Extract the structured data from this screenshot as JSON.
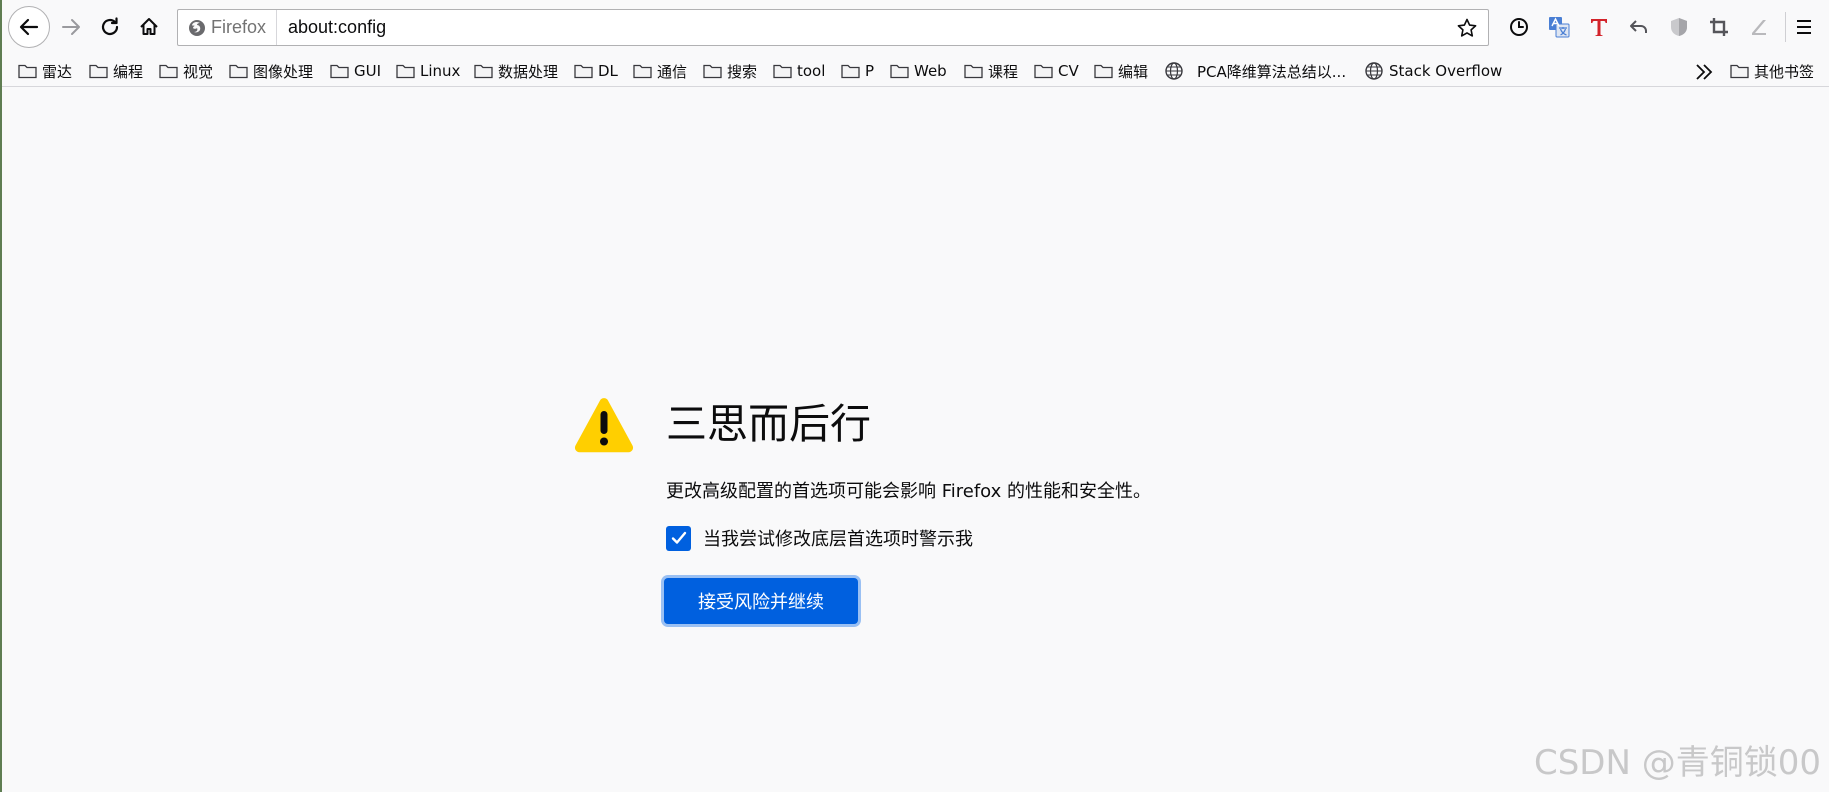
{
  "browser": {
    "identity_label": "Firefox",
    "url": "about:config"
  },
  "bookmarks": [
    {
      "label": "雷达",
      "icon": "folder-icon"
    },
    {
      "label": "编程",
      "icon": "folder-icon"
    },
    {
      "label": "视觉",
      "icon": "folder-icon"
    },
    {
      "label": "图像处理",
      "icon": "folder-icon"
    },
    {
      "label": "GUI",
      "icon": "folder-icon"
    },
    {
      "label": "Linux",
      "icon": "folder-icon"
    },
    {
      "label": "数据处理",
      "icon": "folder-icon"
    },
    {
      "label": "DL",
      "icon": "folder-icon"
    },
    {
      "label": "通信",
      "icon": "folder-icon"
    },
    {
      "label": "搜索",
      "icon": "folder-icon"
    },
    {
      "label": "tool",
      "icon": "folder-icon"
    },
    {
      "label": "P",
      "icon": "folder-icon"
    },
    {
      "label": "Web",
      "icon": "folder-icon"
    },
    {
      "label": "课程",
      "icon": "folder-icon"
    },
    {
      "label": "CV",
      "icon": "folder-icon"
    },
    {
      "label": "编辑",
      "icon": "folder-icon"
    },
    {
      "label": "PCA降维算法总结以...",
      "icon": "globe-icon"
    },
    {
      "label": "Stack Overflow",
      "icon": "globe-icon"
    }
  ],
  "other_bookmarks": {
    "label": "其他书签",
    "icon": "folder-icon"
  },
  "warning": {
    "title": "三思而后行",
    "description": "更改高级配置的首选项可能会影响 Firefox 的性能和安全性。",
    "checkbox_label": "当我尝试修改底层首选项时警示我",
    "checkbox_checked": true,
    "accept_button": "接受风险并继续"
  },
  "watermark": "CSDN @青铜锁00",
  "colors": {
    "accent": "#0060df",
    "warning": "#ffcf00"
  }
}
